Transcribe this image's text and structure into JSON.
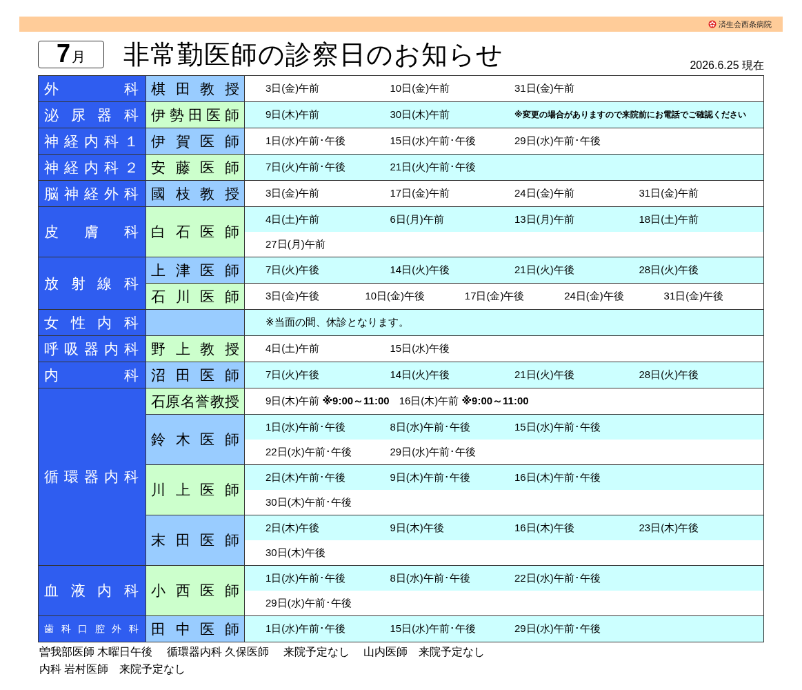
{
  "header": {
    "hospital": "済生会西条病院"
  },
  "month": {
    "number": "7",
    "unit": "月"
  },
  "title": "非常勤医師の診察日のお知らせ",
  "as_of": "2026.6.25 現在",
  "departments": [
    {
      "name": "外科",
      "small_label": false,
      "doctors": [
        {
          "name": "棋田教授",
          "color": "#99ccff",
          "lines": [
            {
              "highlighted": false,
              "entries": [
                {
                  "kind": "date",
                  "text": "3日(金)午前"
                },
                {
                  "kind": "date",
                  "text": "10日(金)午前"
                },
                {
                  "kind": "date",
                  "text": "31日(金)午前"
                }
              ]
            }
          ]
        }
      ]
    },
    {
      "name": "泌尿器科",
      "small_label": false,
      "doctors": [
        {
          "name": "伊勢田医師",
          "color": "#ccffcc",
          "lines": [
            {
              "highlighted": true,
              "entries": [
                {
                  "kind": "date",
                  "text": "9日(木)午前"
                },
                {
                  "kind": "date",
                  "text": "30日(木)午前"
                },
                {
                  "kind": "note",
                  "text": "※変更の場合がありますので来院前にお電話でご確認ください"
                }
              ]
            }
          ]
        }
      ]
    },
    {
      "name": "神経内科１",
      "small_label": false,
      "doctors": [
        {
          "name": "伊賀医師",
          "color": "#99ccff",
          "lines": [
            {
              "highlighted": false,
              "entries": [
                {
                  "kind": "date",
                  "text": "1日(水)午前･午後"
                },
                {
                  "kind": "date",
                  "text": "15日(水)午前･午後"
                },
                {
                  "kind": "date",
                  "text": "29日(水)午前･午後"
                }
              ]
            }
          ]
        }
      ]
    },
    {
      "name": "神経内科２",
      "small_label": false,
      "doctors": [
        {
          "name": "安藤医師",
          "color": "#ccffcc",
          "lines": [
            {
              "highlighted": true,
              "entries": [
                {
                  "kind": "date",
                  "text": "7日(火)午前･午後"
                },
                {
                  "kind": "date",
                  "text": "21日(火)午前･午後"
                }
              ]
            }
          ]
        }
      ]
    },
    {
      "name": "脳神経外科",
      "small_label": false,
      "doctors": [
        {
          "name": "國枝教授",
          "color": "#99ccff",
          "lines": [
            {
              "highlighted": false,
              "entries": [
                {
                  "kind": "date",
                  "text": "3日(金)午前"
                },
                {
                  "kind": "date",
                  "text": "17日(金)午前"
                },
                {
                  "kind": "date",
                  "text": "24日(金)午前"
                },
                {
                  "kind": "date",
                  "text": "31日(金)午前"
                }
              ]
            }
          ]
        }
      ]
    },
    {
      "name": "皮膚科",
      "small_label": false,
      "doctors": [
        {
          "name": "白石医師",
          "color": "#ccffcc",
          "lines": [
            {
              "highlighted": true,
              "entries": [
                {
                  "kind": "date",
                  "text": "4日(土)午前"
                },
                {
                  "kind": "date",
                  "text": "6日(月)午前"
                },
                {
                  "kind": "date",
                  "text": "13日(月)午前"
                },
                {
                  "kind": "date",
                  "text": "18日(土)午前"
                }
              ]
            },
            {
              "highlighted": false,
              "entries": [
                {
                  "kind": "date",
                  "text": "27日(月)午前"
                }
              ]
            }
          ]
        }
      ]
    },
    {
      "name": "放射線科",
      "small_label": false,
      "doctors": [
        {
          "name": "上津医師",
          "color": "#99ccff",
          "lines": [
            {
              "highlighted": true,
              "entries": [
                {
                  "kind": "date",
                  "text": "7日(火)午後"
                },
                {
                  "kind": "date",
                  "text": "14日(火)午後"
                },
                {
                  "kind": "date",
                  "text": "21日(火)午後"
                },
                {
                  "kind": "date",
                  "text": "28日(火)午後"
                }
              ]
            }
          ]
        },
        {
          "name": "石川医師",
          "color": "#ccffcc",
          "lines": [
            {
              "highlighted": false,
              "entries": [
                {
                  "kind": "date",
                  "text": "3日(金)午後"
                },
                {
                  "kind": "date",
                  "text": "10日(金)午後"
                },
                {
                  "kind": "date",
                  "text": "17日(金)午後"
                },
                {
                  "kind": "date",
                  "text": "24日(金)午後"
                },
                {
                  "kind": "date",
                  "text": "31日(金)午後"
                }
              ]
            }
          ]
        }
      ]
    },
    {
      "name": "女性内科",
      "small_label": false,
      "doctors": [
        {
          "color": "#99ccff",
          "lines": [
            {
              "highlighted": true,
              "entries": [
                {
                  "kind": "remark",
                  "text": "※当面の間、休診となります。"
                }
              ]
            }
          ]
        }
      ]
    },
    {
      "name": "呼吸器内科",
      "small_label": false,
      "doctors": [
        {
          "name": "野上教授",
          "color": "#ccffcc",
          "lines": [
            {
              "highlighted": false,
              "entries": [
                {
                  "kind": "date",
                  "text": "4日(土)午前"
                },
                {
                  "kind": "date",
                  "text": "15日(水)午後"
                }
              ]
            }
          ]
        }
      ]
    },
    {
      "name": "内科",
      "small_label": false,
      "doctors": [
        {
          "name": "沼田医師",
          "color": "#99ccff",
          "lines": [
            {
              "highlighted": true,
              "entries": [
                {
                  "kind": "date",
                  "text": "7日(火)午後"
                },
                {
                  "kind": "date",
                  "text": "14日(火)午後"
                },
                {
                  "kind": "date",
                  "text": "21日(火)午後"
                },
                {
                  "kind": "date",
                  "text": "28日(火)午後"
                }
              ]
            }
          ]
        }
      ]
    },
    {
      "name": "循環器内科",
      "small_label": false,
      "doctors": [
        {
          "name": "石原名誉教授",
          "color": "#ccffcc",
          "lines": [
            {
              "highlighted": false,
              "entries": [
                {
                  "kind": "date",
                  "text": "9日(木)午前 **※9:00～11:00**"
                },
                {
                  "kind": "date",
                  "text": "16日(木)午前 **※9:00～11:00**"
                }
              ]
            }
          ]
        },
        {
          "name": "鈴木医師",
          "color": "#99ccff",
          "lines": [
            {
              "highlighted": true,
              "entries": [
                {
                  "kind": "date",
                  "text": "1日(水)午前･午後"
                },
                {
                  "kind": "date",
                  "text": "8日(水)午前･午後"
                },
                {
                  "kind": "date",
                  "text": "15日(水)午前･午後"
                }
              ]
            },
            {
              "highlighted": false,
              "entries": [
                {
                  "kind": "date",
                  "text": "22日(水)午前･午後"
                },
                {
                  "kind": "date",
                  "text": "29日(水)午前･午後"
                }
              ]
            }
          ]
        },
        {
          "name": "川上医師",
          "color": "#ccffcc",
          "lines": [
            {
              "highlighted": true,
              "entries": [
                {
                  "kind": "date",
                  "text": "2日(木)午前･午後"
                },
                {
                  "kind": "date",
                  "text": "9日(木)午前･午後"
                },
                {
                  "kind": "date",
                  "text": "16日(木)午前･午後"
                }
              ]
            },
            {
              "highlighted": false,
              "entries": [
                {
                  "kind": "date",
                  "text": "30日(木)午前･午後"
                }
              ]
            }
          ]
        },
        {
          "name": "末田医師",
          "color": "#99ccff",
          "lines": [
            {
              "highlighted": true,
              "entries": [
                {
                  "kind": "date",
                  "text": "2日(木)午後"
                },
                {
                  "kind": "date",
                  "text": "9日(木)午後"
                },
                {
                  "kind": "date",
                  "text": "16日(木)午後"
                },
                {
                  "kind": "date",
                  "text": "23日(木)午後"
                }
              ]
            },
            {
              "highlighted": false,
              "entries": [
                {
                  "kind": "date",
                  "text": "30日(木)午後"
                }
              ]
            }
          ]
        }
      ]
    },
    {
      "name": "血液内科",
      "small_label": false,
      "doctors": [
        {
          "name": "小西医師",
          "color": "#ccffcc",
          "lines": [
            {
              "highlighted": true,
              "entries": [
                {
                  "kind": "date",
                  "text": "1日(水)午前･午後"
                },
                {
                  "kind": "date",
                  "text": "8日(水)午前･午後"
                },
                {
                  "kind": "date",
                  "text": "22日(水)午前･午後"
                }
              ]
            },
            {
              "highlighted": false,
              "entries": [
                {
                  "kind": "date",
                  "text": "29日(水)午前･午後"
                }
              ]
            }
          ]
        }
      ]
    },
    {
      "name": "歯科口腔外科",
      "small_label": true,
      "doctors": [
        {
          "name": "田中医師",
          "color": "#99ccff",
          "lines": [
            {
              "highlighted": true,
              "entries": [
                {
                  "kind": "date",
                  "text": "1日(水)午前･午後"
                },
                {
                  "kind": "date",
                  "text": "15日(水)午前･午後"
                },
                {
                  "kind": "date",
                  "text": "29日(水)午前･午後"
                }
              ]
            }
          ]
        }
      ]
    }
  ],
  "footnotes": [
    "曽我部医師 木曜日午後　 循環器内科 久保医師　 来院予定なし　 山内医師　来院予定なし",
    "内科 岩村医師　来院予定なし"
  ]
}
